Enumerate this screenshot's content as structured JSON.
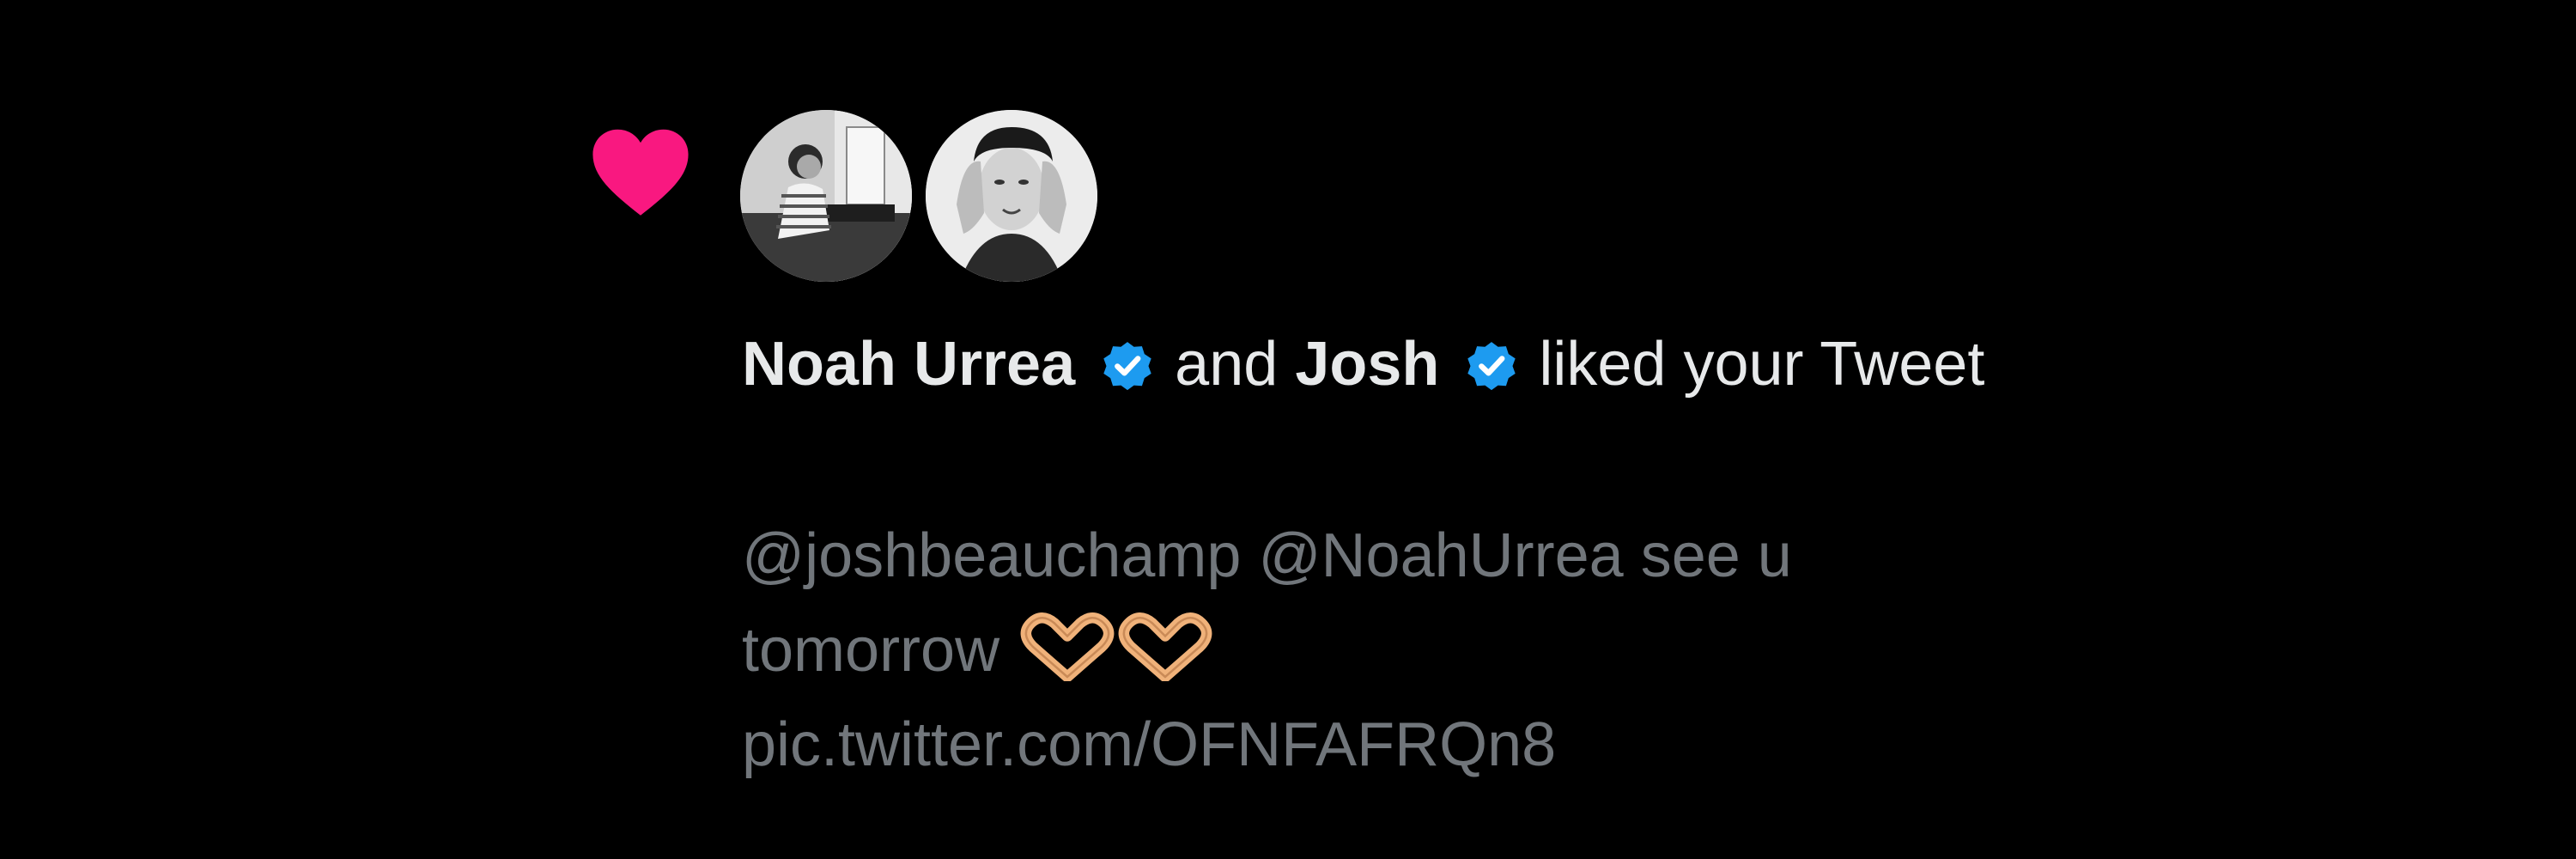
{
  "notification": {
    "type_icon": "heart-icon",
    "accent_color": "#f91880",
    "verified_color": "#1d9bf0",
    "avatars": [
      {
        "icon": "avatar-person-piano"
      },
      {
        "icon": "avatar-person-hands-on-head"
      }
    ],
    "user1_name": "Noah Urrea",
    "conjunction": "and",
    "user2_name": "Josh",
    "action_text": "liked your Tweet",
    "tweet_text": "@joshbeauchamp @NoahUrrea see u tomorrow",
    "emojis": [
      "heart-hands-emoji",
      "heart-hands-emoji"
    ],
    "tweet_link": "pic.twitter.com/OFNFAFRQn8"
  }
}
